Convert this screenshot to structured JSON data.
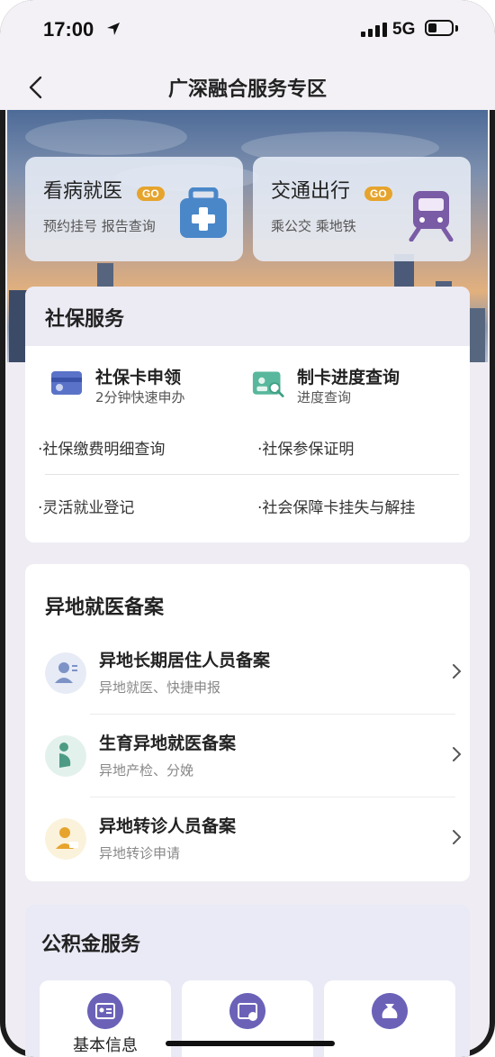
{
  "status_bar": {
    "time": "17:00",
    "network": "5G"
  },
  "nav": {
    "title": "广深融合服务专区"
  },
  "top_cards": [
    {
      "title": "看病就医",
      "badge": "GO",
      "subtitle": "预约挂号 报告查询",
      "icon": "medical-kit-icon"
    },
    {
      "title": "交通出行",
      "badge": "GO",
      "subtitle": "乘公交 乘地铁",
      "icon": "metro-train-icon"
    }
  ],
  "social": {
    "title": "社保服务",
    "services": [
      {
        "title": "社保卡申领",
        "subtitle": "2分钟快速申办",
        "icon": "card-icon"
      },
      {
        "title": "制卡进度查询",
        "subtitle": "进度查询",
        "icon": "card-search-icon"
      }
    ],
    "links": [
      "·社保缴费明细查询",
      "·社保参保证明",
      "·灵活就业登记",
      "·社会保障卡挂失与解挂"
    ]
  },
  "remote_medical": {
    "title": "异地就医备案",
    "items": [
      {
        "title": "异地长期居住人员备案",
        "subtitle": "异地就医、快捷申报",
        "icon": "resident-icon"
      },
      {
        "title": "生育异地就医备案",
        "subtitle": "异地产检、分娩",
        "icon": "pregnant-icon"
      },
      {
        "title": "异地转诊人员备案",
        "subtitle": "异地转诊申请",
        "icon": "referral-icon"
      }
    ]
  },
  "provident_fund": {
    "title": "公积金服务",
    "items": [
      {
        "label": "基本信息",
        "icon": "id-card-icon"
      },
      {
        "label": "",
        "icon": "withdraw-icon"
      },
      {
        "label": "",
        "icon": "money-bag-icon"
      }
    ]
  },
  "colors": {
    "accent_go": "#e6a42d",
    "icon_purple": "#6b62b8",
    "medical_blue": "#4a87c9"
  }
}
